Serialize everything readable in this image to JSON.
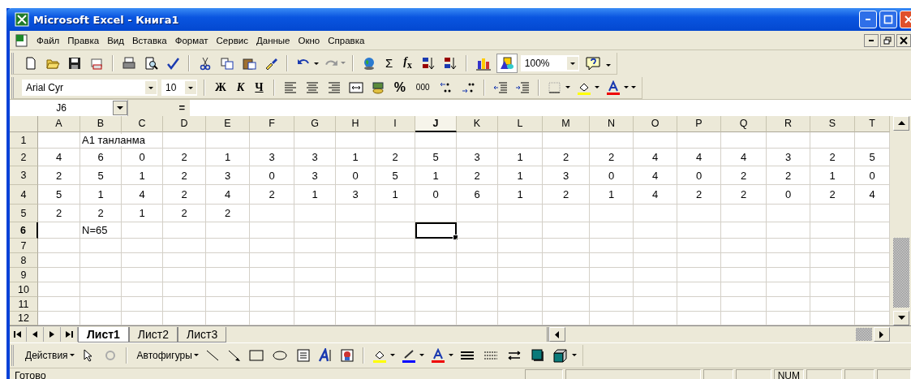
{
  "window": {
    "title": "Microsoft Excel - Книга1"
  },
  "menu": [
    "Файл",
    "Правка",
    "Вид",
    "Вставка",
    "Формат",
    "Сервис",
    "Данные",
    "Окно",
    "Справка"
  ],
  "standard_toolbar": {
    "sum": "Σ",
    "function": "*f*$_{x}$",
    "zoom": "100%"
  },
  "formatting_toolbar": {
    "font": "Arial Cyr",
    "size": "10",
    "bold": "Ж",
    "italic": "К",
    "underline": "Ч",
    "percent": "%",
    "thousands": "000"
  },
  "formula_bar": {
    "name_box": "J6",
    "equals": "="
  },
  "columns": [
    {
      "label": "A",
      "selected": false
    },
    {
      "label": "B",
      "selected": false
    },
    {
      "label": "C",
      "selected": false
    },
    {
      "label": "D",
      "selected": false
    },
    {
      "label": "E",
      "selected": false
    },
    {
      "label": "F",
      "selected": false
    },
    {
      "label": "G",
      "selected": false
    },
    {
      "label": "H",
      "selected": false
    },
    {
      "label": "I",
      "selected": false
    },
    {
      "label": "J",
      "selected": true
    },
    {
      "label": "K",
      "selected": false
    },
    {
      "label": "L",
      "selected": false
    },
    {
      "label": "M",
      "selected": false
    },
    {
      "label": "N",
      "selected": false
    },
    {
      "label": "O",
      "selected": false
    },
    {
      "label": "P",
      "selected": false
    },
    {
      "label": "Q",
      "selected": false
    },
    {
      "label": "R",
      "selected": false
    },
    {
      "label": "S",
      "selected": false
    },
    {
      "label": "T",
      "selected": false
    }
  ],
  "rows": [
    {
      "header": "1",
      "selected": false,
      "cells": [
        null,
        "А1 танланма"
      ]
    },
    {
      "header": "2",
      "selected": false,
      "cells": [
        "4",
        "6",
        "0",
        "2",
        "1",
        "3",
        "3",
        "1",
        "2",
        "5",
        "3",
        "1",
        "2",
        "2",
        "4",
        "4",
        "4",
        "3",
        "2",
        "5"
      ]
    },
    {
      "header": "3",
      "selected": false,
      "cells": [
        "2",
        "5",
        "1",
        "2",
        "3",
        "0",
        "3",
        "0",
        "5",
        "1",
        "2",
        "1",
        "3",
        "0",
        "4",
        "0",
        "2",
        "2",
        "1",
        "0"
      ]
    },
    {
      "header": "4",
      "selected": false,
      "cells": [
        "5",
        "1",
        "4",
        "2",
        "4",
        "2",
        "1",
        "3",
        "1",
        "0",
        "6",
        "1",
        "2",
        "1",
        "4",
        "2",
        "2",
        "0",
        "2",
        "4"
      ]
    },
    {
      "header": "5",
      "selected": false,
      "cells": [
        "2",
        "2",
        "1",
        "2",
        "2"
      ]
    },
    {
      "header": "6",
      "selected": true,
      "cells": [
        null,
        "N=65"
      ]
    },
    {
      "header": "7",
      "selected": false
    },
    {
      "header": "8",
      "selected": false
    },
    {
      "header": "9",
      "selected": false
    },
    {
      "header": "10",
      "selected": false
    },
    {
      "header": "11",
      "selected": false
    },
    {
      "header": "12",
      "selected": false
    }
  ],
  "sheet_tabs": [
    {
      "label": "Лист1",
      "selected": true
    },
    {
      "label": "Лист2",
      "selected": false
    },
    {
      "label": "Лист3",
      "selected": false
    }
  ],
  "drawing_toolbar": {
    "actions": "Действия",
    "autoshapes": "Автофигуры"
  },
  "status_bar": {
    "text": "Готово",
    "indicator": "NUM"
  }
}
